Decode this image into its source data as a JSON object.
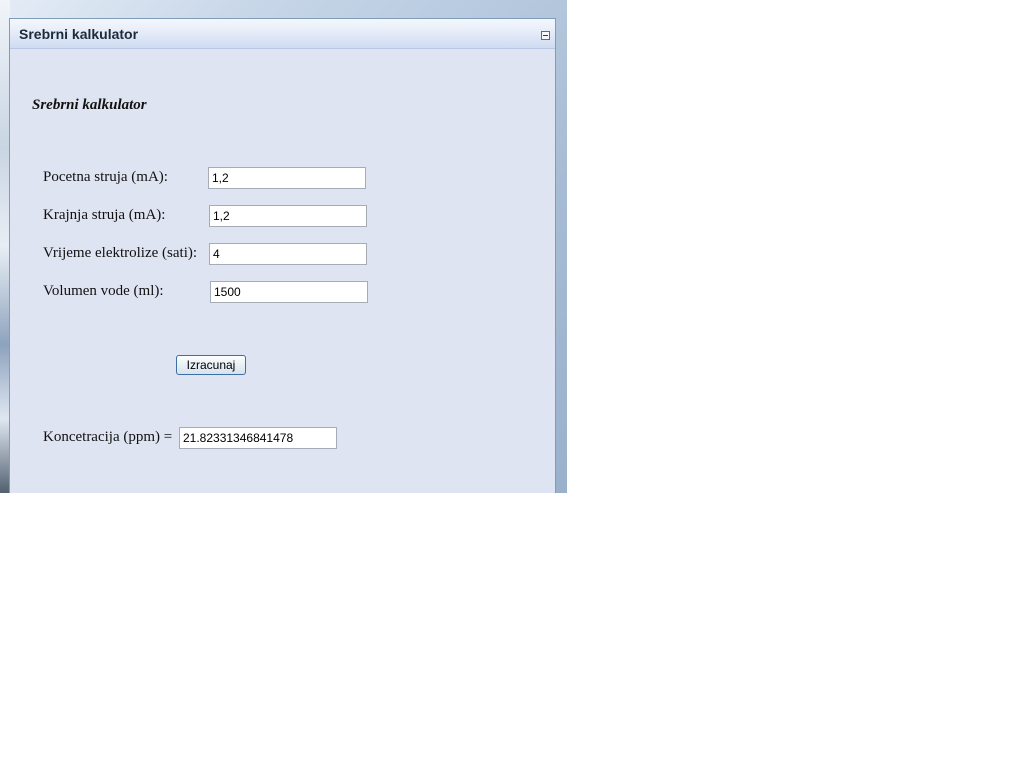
{
  "panel": {
    "title": "Srebrni kalkulator",
    "collapse_icon": "minus-box-icon"
  },
  "form": {
    "heading": "Srebrni kalkulator",
    "fields": [
      {
        "label": "Pocetna struja (mA):",
        "value": "1,2"
      },
      {
        "label": "Krajnja struja (mA):",
        "value": "1,2"
      },
      {
        "label": "Vrijeme elektrolize (sati):",
        "value": "4"
      },
      {
        "label": "Volumen vode (ml):",
        "value": "1500"
      }
    ],
    "calculate_label": "Izracunaj",
    "result_label": "Koncetracija (ppm) =",
    "result_value": "21.82331346841478"
  }
}
